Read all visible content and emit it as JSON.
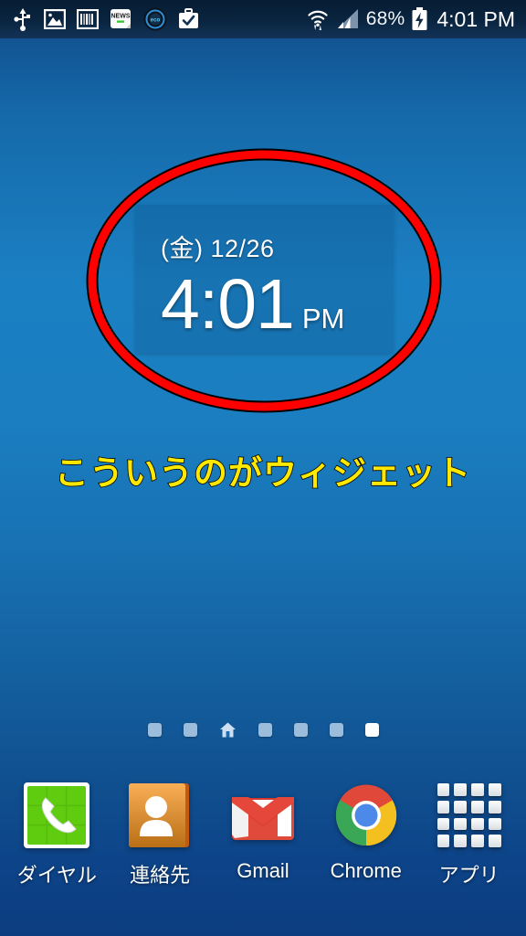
{
  "statusbar": {
    "left_icons": [
      {
        "name": "usb-icon",
        "label": "USB"
      },
      {
        "name": "image-icon",
        "label": "Screenshot"
      },
      {
        "name": "barcode-icon",
        "label": "Barcode"
      },
      {
        "name": "news-icon",
        "label": "NEWS"
      },
      {
        "name": "eco-icon",
        "label": "eco"
      },
      {
        "name": "briefcase-check-icon",
        "label": "Briefcase"
      }
    ],
    "wifi_icon": "wifi-icon",
    "signal_icon": "signal-bars-icon",
    "battery_percent": "68%",
    "battery_icon": "battery-charging-icon",
    "clock": "4:01 PM"
  },
  "widget": {
    "name": "clock-widget",
    "date": "(金) 12/26",
    "time": "4:01",
    "ampm": "PM"
  },
  "annotation": {
    "caption": "こういうのがウィジェット",
    "ellipse_color": "#ff0000",
    "ellipse_outline_color": "#000000",
    "caption_color": "#ffe800",
    "caption_outline_color": "#000000"
  },
  "page_indicator": {
    "pages": [
      {
        "type": "dot",
        "active": false
      },
      {
        "type": "dot",
        "active": false
      },
      {
        "type": "home",
        "active": false
      },
      {
        "type": "dot",
        "active": false
      },
      {
        "type": "dot",
        "active": false
      },
      {
        "type": "dot",
        "active": false
      },
      {
        "type": "dot",
        "active": true
      }
    ],
    "count": 7,
    "current": 7
  },
  "dock": {
    "items": [
      {
        "name": "dock-item-dialer",
        "label": "ダイヤル",
        "icon": "phone-icon"
      },
      {
        "name": "dock-item-contacts",
        "label": "連絡先",
        "icon": "contacts-icon"
      },
      {
        "name": "dock-item-gmail",
        "label": "Gmail",
        "icon": "gmail-icon"
      },
      {
        "name": "dock-item-chrome",
        "label": "Chrome",
        "icon": "chrome-icon"
      },
      {
        "name": "dock-item-apps",
        "label": "アプリ",
        "icon": "apps-grid-icon"
      }
    ]
  },
  "wallpaper": {
    "top_color": "#0c3d7a",
    "mid_color": "#1b80c3",
    "bottom_color": "#0c3c80"
  }
}
